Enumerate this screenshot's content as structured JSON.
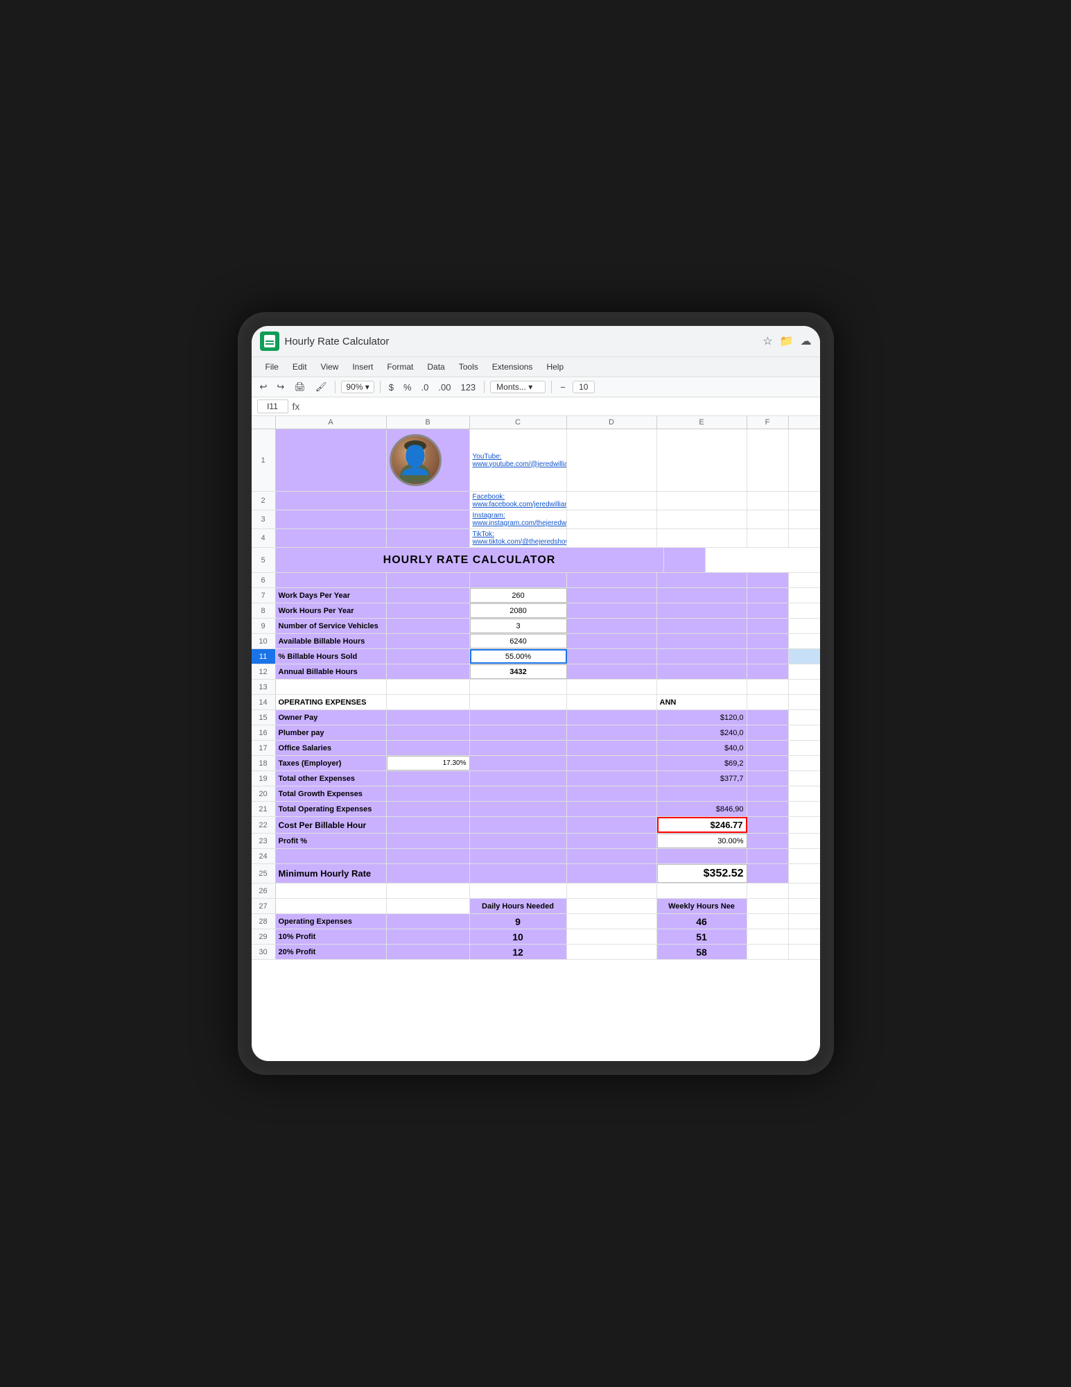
{
  "app": {
    "icon_alt": "Google Sheets",
    "title": "Hourly Rate Calculator",
    "menu_items": [
      "File",
      "Edit",
      "View",
      "Insert",
      "Format",
      "Data",
      "Tools",
      "Extensions",
      "Help"
    ],
    "toolbar": {
      "undo": "↩",
      "redo": "↪",
      "print": "🖨",
      "paint": "🖌",
      "zoom": "90%",
      "currency": "$",
      "percent": "%",
      "decimal_less": ".0",
      "decimal_more": ".00",
      "format_123": "123",
      "font": "Monts...",
      "font_size": "10"
    },
    "formula_bar": {
      "cell_ref": "I11",
      "formula_icon": "fx"
    }
  },
  "columns": {
    "headers": [
      "",
      "A",
      "B",
      "C",
      "D",
      "E",
      "F"
    ]
  },
  "rows": [
    {
      "num": "1",
      "a": "",
      "b": "",
      "c": "YouTube: www.youtube.com/@jeredwilliams",
      "d": "",
      "e": "",
      "f": "",
      "a_bg": "white",
      "b_bg": "white",
      "c_bg": "white",
      "is_link": true,
      "has_avatar": true
    },
    {
      "num": "2",
      "a": "",
      "b": "",
      "c": "Facebook: www.facebook.com/jeredwilliamsshow",
      "d": "",
      "e": "",
      "f": "",
      "is_link": true
    },
    {
      "num": "3",
      "a": "",
      "b": "",
      "c": "Instagram: www.instagram.com/thejeredwilliamsshow/",
      "d": "",
      "e": "",
      "f": "",
      "is_link": true
    },
    {
      "num": "4",
      "a": "",
      "b": "",
      "c": "TikTok: www.tiktok.com/@thejeredshow",
      "d": "",
      "e": "",
      "f": "",
      "is_link": true
    },
    {
      "num": "5",
      "a": "HOURLY RATE CALCULATOR",
      "is_title": true,
      "bg_purple": true
    },
    {
      "num": "6",
      "a": "",
      "bg_purple": true,
      "is_empty_purple": true
    },
    {
      "num": "7",
      "a": "Work Days Per Year",
      "b": "",
      "c": "260",
      "a_bold": true,
      "a_bg": "purple",
      "c_bg": "white",
      "input_row": true
    },
    {
      "num": "8",
      "a": "Work Hours Per Year",
      "b": "",
      "c": "2080",
      "a_bold": true,
      "a_bg": "purple",
      "c_bg": "white",
      "input_row": true
    },
    {
      "num": "9",
      "a": "Number of Service Vehicles",
      "b": "",
      "c": "3",
      "a_bold": true,
      "a_bg": "purple",
      "c_bg": "white",
      "input_row": true
    },
    {
      "num": "10",
      "a": "Available Billable Hours",
      "b": "",
      "c": "6240",
      "a_bold": true,
      "a_bg": "purple",
      "c_bg": "white",
      "input_row": true
    },
    {
      "num": "11",
      "a": "% Billable Hours Sold",
      "b": "",
      "c": "55.00%",
      "a_bold": true,
      "a_bg": "purple",
      "c_bg": "white",
      "is_selected": true,
      "input_row": true
    },
    {
      "num": "12",
      "a": "Annual Billable Hours",
      "b": "",
      "c": "3432",
      "a_bold": true,
      "c_bold": true,
      "a_bg": "purple",
      "c_bg": "white"
    },
    {
      "num": "13",
      "a": "",
      "is_empty_section": true
    },
    {
      "num": "14",
      "a": "OPERATING EXPENSES",
      "e": "ANN",
      "a_bold": true,
      "is_section_header": true
    },
    {
      "num": "15",
      "a": "Owner Pay",
      "e": "$120,0",
      "a_bold": true,
      "a_bg": "purple",
      "e_bg": "purple"
    },
    {
      "num": "16",
      "a": "Plumber pay",
      "e": "$240,0",
      "a_bold": true,
      "a_bg": "purple",
      "e_bg": "purple"
    },
    {
      "num": "17",
      "a": "Office Salaries",
      "e": "$40,0",
      "a_bold": true,
      "a_bg": "purple",
      "e_bg": "purple"
    },
    {
      "num": "18",
      "a": "Taxes (Employer)",
      "b_val": "17.30%",
      "e": "$69,2",
      "a_bold": true,
      "a_bg": "purple",
      "e_bg": "purple"
    },
    {
      "num": "19",
      "a": "Total other Expenses",
      "e": "$377,7",
      "a_bold": true,
      "a_bg": "purple",
      "e_bg": "purple"
    },
    {
      "num": "20",
      "a": "Total Growth Expenses",
      "a_bold": true,
      "a_bg": "purple",
      "e_bg": "purple"
    },
    {
      "num": "21",
      "a": "Total Operating Expenses",
      "e": "$846,90",
      "a_bold": true,
      "a_bg": "purple",
      "e_bg": "purple"
    },
    {
      "num": "22",
      "a": "Cost Per Billable Hour",
      "e": "$246.77",
      "a_bold": true,
      "e_bold": true,
      "a_bg": "purple",
      "e_red_border": true,
      "e_bg": "white"
    },
    {
      "num": "23",
      "a": "Profit %",
      "e": "30.00%",
      "a_bold": true,
      "a_bg": "purple",
      "e_bg": "white"
    },
    {
      "num": "24",
      "a": "",
      "a_bg": "purple",
      "is_empty_purple": true
    },
    {
      "num": "25",
      "a": "Minimum Hourly Rate",
      "e": "$352.52",
      "a_bold": true,
      "e_bold": true,
      "a_bg": "purple",
      "e_large": true,
      "e_bg": "white"
    },
    {
      "num": "26",
      "a": "",
      "is_empty_section": true
    },
    {
      "num": "27",
      "a": "",
      "c": "Daily Hours Needed",
      "e": "Weekly Hours Nee",
      "c_bold": true,
      "e_bold": true,
      "is_header_row": true
    },
    {
      "num": "28",
      "a": "Operating Expenses",
      "c": "9",
      "e": "46",
      "a_bold": true,
      "c_bold": true,
      "e_bold": true,
      "a_bg": "purple",
      "c_bg": "purple",
      "e_bg": "purple"
    },
    {
      "num": "29",
      "a": "10% Profit",
      "c": "10",
      "e": "51",
      "a_bold": true,
      "c_bold": true,
      "e_bold": true,
      "a_bg": "purple",
      "c_bg": "purple",
      "e_bg": "purple"
    },
    {
      "num": "30",
      "a": "20% Profit",
      "c": "12",
      "e": "58",
      "a_bold": true,
      "c_bold": true,
      "e_bold": true,
      "a_bg": "purple",
      "c_bg": "purple",
      "e_bg": "purple"
    }
  ]
}
